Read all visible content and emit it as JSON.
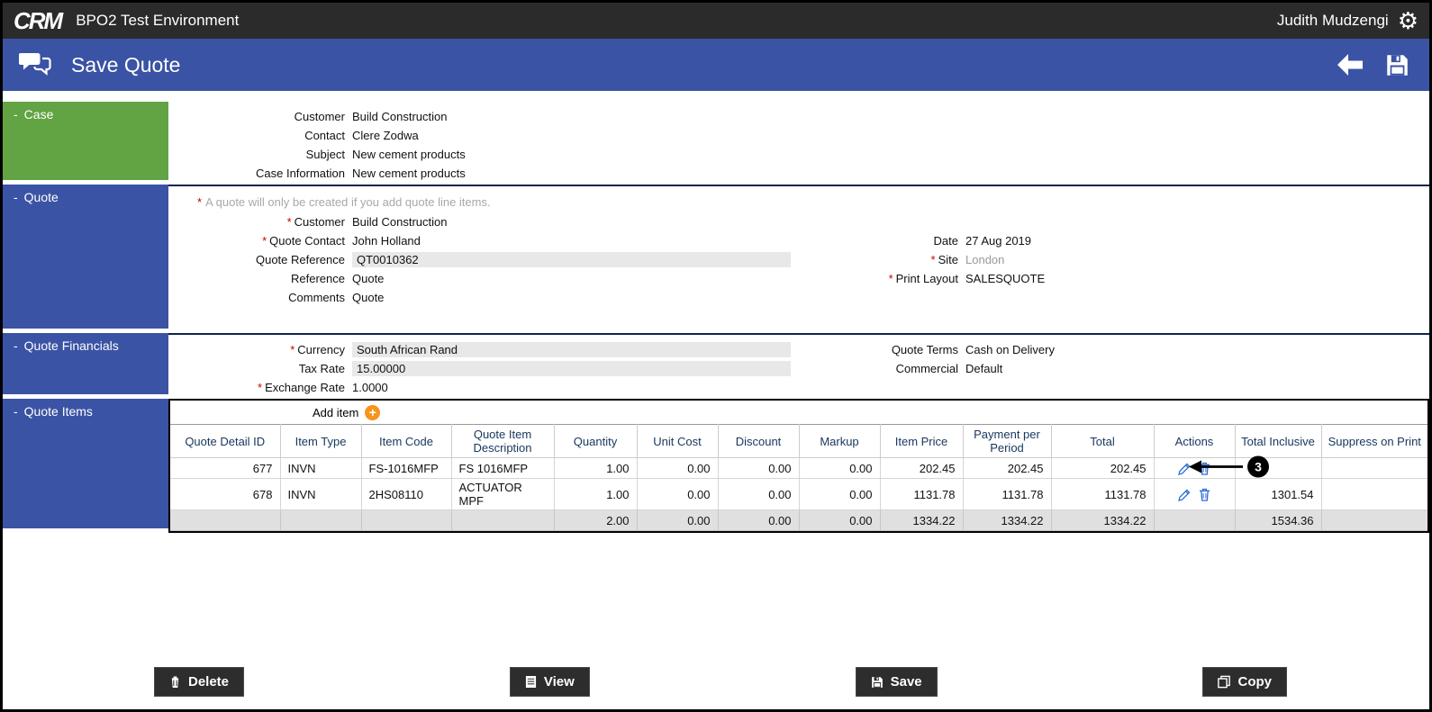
{
  "topbar": {
    "logo": "CRM",
    "title": "BPO2 Test Environment",
    "user": "Judith Mudzengi"
  },
  "header": {
    "title": "Save Quote"
  },
  "glyphs": {
    "collapse": "-",
    "gear": "⚙",
    "plus": "+"
  },
  "case": {
    "title": "Case",
    "fields": [
      {
        "label": "Customer",
        "value": "Build Construction"
      },
      {
        "label": "Contact",
        "value": "Clere Zodwa"
      },
      {
        "label": "Subject",
        "value": "New cement products"
      },
      {
        "label": "Case Information",
        "value": "New cement products"
      }
    ]
  },
  "quote": {
    "title": "Quote",
    "note_req": "*",
    "note": "A quote will only be created if you add quote line items.",
    "fields_left": [
      {
        "req": "*",
        "label": "Customer",
        "value": "Build Construction"
      },
      {
        "req": "*",
        "label": "Quote Contact",
        "value": "John Holland"
      },
      {
        "label": "Quote Reference",
        "value": "QT0010362"
      },
      {
        "label": "Reference",
        "value": "Quote"
      },
      {
        "label": "Comments",
        "value": "Quote"
      }
    ],
    "fields_right": [
      {
        "label": "Date",
        "value": "27 Aug 2019"
      },
      {
        "req": "*",
        "label": "Site",
        "value": "London"
      },
      {
        "req": "*",
        "label": "Print Layout",
        "value": "SALESQUOTE"
      }
    ]
  },
  "financials": {
    "title": "Quote Financials",
    "fields_left": [
      {
        "req": "*",
        "label": "Currency",
        "value": "South African Rand"
      },
      {
        "label": "Tax Rate",
        "value": "15.00000"
      },
      {
        "req": "*",
        "label": "Exchange Rate",
        "value": "1.0000"
      }
    ],
    "fields_right": [
      {
        "label": "Quote Terms",
        "value": "Cash on Delivery"
      },
      {
        "label": "Commercial",
        "value": "Default"
      }
    ]
  },
  "items": {
    "title": "Quote Items",
    "add_label": "Add item",
    "columns": [
      "Quote Detail ID",
      "Item Type",
      "Item Code",
      "Quote Item Description",
      "Quantity",
      "Unit Cost",
      "Discount",
      "Markup",
      "Item Price",
      "Payment per Period",
      "Total",
      "Actions",
      "Total Inclusive",
      "Suppress on Print"
    ],
    "rows": [
      {
        "detail_id": "677",
        "item_type": "INVN",
        "item_code": "FS-1016MFP",
        "description": "FS 1016MFP",
        "quantity": "1.00",
        "unit_cost": "0.00",
        "discount": "0.00",
        "markup": "0.00",
        "item_price": "202.45",
        "payment_per_period": "202.45",
        "total": "202.45",
        "total_inclusive": ""
      },
      {
        "detail_id": "678",
        "item_type": "INVN",
        "item_code": "2HS08110",
        "description": "ACTUATOR MPF",
        "quantity": "1.00",
        "unit_cost": "0.00",
        "discount": "0.00",
        "markup": "0.00",
        "item_price": "1131.78",
        "payment_per_period": "1131.78",
        "total": "1131.78",
        "total_inclusive": "1301.54"
      }
    ],
    "totals": {
      "quantity": "2.00",
      "unit_cost": "0.00",
      "discount": "0.00",
      "markup": "0.00",
      "item_price": "1334.22",
      "payment_per_period": "1334.22",
      "total": "1334.22",
      "total_inclusive": "1534.36"
    },
    "annotation": "3"
  },
  "footer": {
    "delete": "Delete",
    "view": "View",
    "save": "Save",
    "copy": "Copy"
  }
}
